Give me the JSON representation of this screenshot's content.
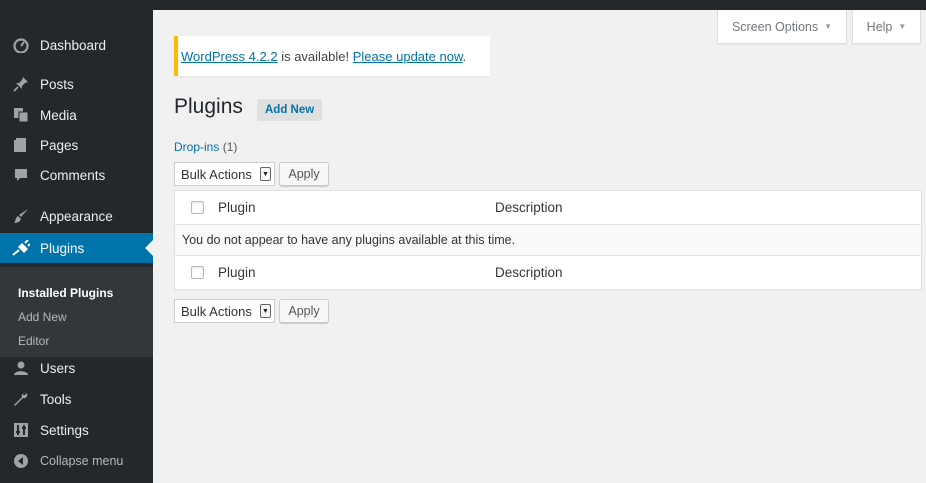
{
  "sidebar": {
    "items": [
      {
        "id": "dashboard",
        "label": "Dashboard",
        "icon": "dashboard-icon"
      },
      {
        "id": "posts",
        "label": "Posts",
        "icon": "pushpin-icon"
      },
      {
        "id": "media",
        "label": "Media",
        "icon": "media-icon"
      },
      {
        "id": "pages",
        "label": "Pages",
        "icon": "pages-icon"
      },
      {
        "id": "comments",
        "label": "Comments",
        "icon": "comment-icon"
      },
      {
        "id": "appearance",
        "label": "Appearance",
        "icon": "paintbrush-icon"
      },
      {
        "id": "plugins",
        "label": "Plugins",
        "icon": "plugin-icon",
        "current": true
      },
      {
        "id": "users",
        "label": "Users",
        "icon": "users-icon"
      },
      {
        "id": "tools",
        "label": "Tools",
        "icon": "wrench-icon"
      },
      {
        "id": "settings",
        "label": "Settings",
        "icon": "settings-icon"
      }
    ],
    "submenu": [
      "Installed Plugins",
      "Add New",
      "Editor"
    ],
    "collapse_label": "Collapse menu"
  },
  "screen_meta": {
    "screen_options": "Screen Options",
    "help": "Help"
  },
  "notice": {
    "version_link": "WordPress 4.2.2",
    "middle_text": " is available! ",
    "update_link": "Please update now",
    "end_text": "."
  },
  "page": {
    "title": "Plugins",
    "add_new": "Add New",
    "filter_label": "Drop-ins",
    "filter_count": "(1)"
  },
  "bulk": {
    "select_label": "Bulk Actions",
    "apply_label": "Apply"
  },
  "table": {
    "columns": [
      "Plugin",
      "Description"
    ],
    "empty_message": "You do not appear to have any plugins available at this time."
  },
  "colors": {
    "sidebar_bg": "#23282d",
    "accent": "#0073aa",
    "notice_border": "#ffba00",
    "page_bg": "#f1f1f1"
  }
}
